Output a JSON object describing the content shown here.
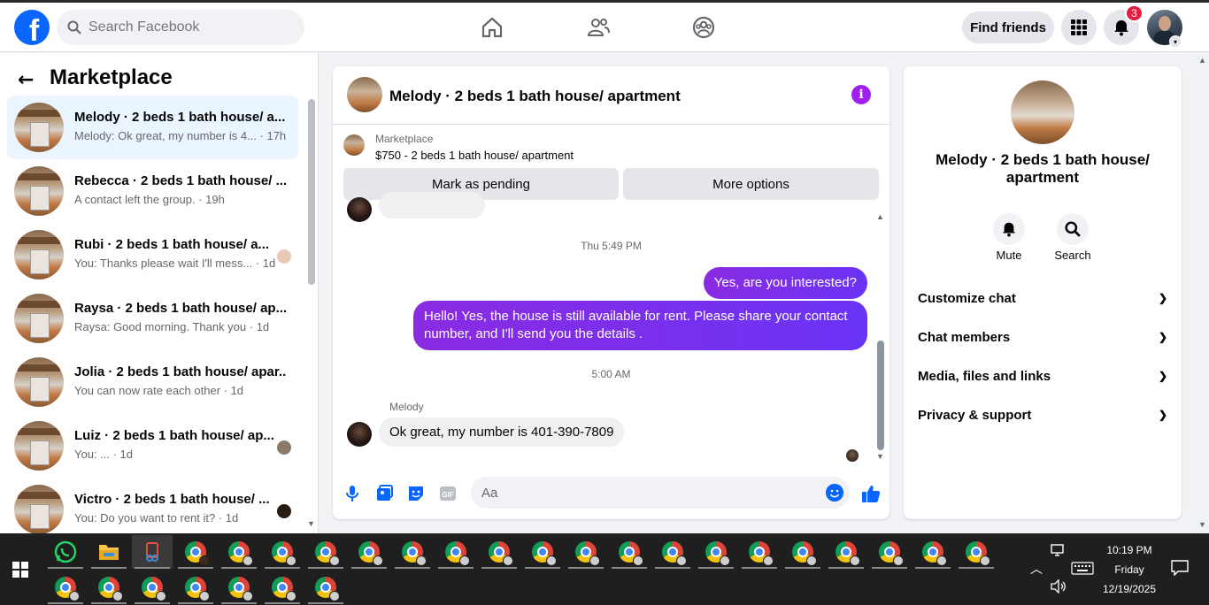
{
  "header": {
    "search_placeholder": "Search Facebook",
    "find_friends": "Find friends",
    "notification_count": "3",
    "logo_letter": "f"
  },
  "sidebar": {
    "title": "Marketplace",
    "conversations": [
      {
        "name": "Melody · 2 beds 1 bath house/ a...",
        "preview": "Melody: Ok great, my number is 4... · 17h",
        "active": true
      },
      {
        "name": "Rebecca · 2 beds 1 bath house/ ...",
        "preview": "A contact left the group. · 19h"
      },
      {
        "name": "Rubi · 2 beds 1 bath house/ a...",
        "preview": "You: Thanks please wait I'll mess... · 1d"
      },
      {
        "name": "Raysa · 2 beds 1 bath house/ ap...",
        "preview": "Raysa: Good morning. Thank you · 1d"
      },
      {
        "name": "Jolia · 2 beds 1 bath house/ apar...",
        "preview": "You can now rate each other · 1d"
      },
      {
        "name": "Luiz · 2 beds 1 bath house/ ap...",
        "preview": "You: ... · 1d"
      },
      {
        "name": "Victro · 2 beds 1 bath house/ ...",
        "preview": "You: Do you want to rent it? · 1d"
      }
    ]
  },
  "chat": {
    "title": "Melody · 2 beds 1 bath house/ apartment",
    "marketplace_label": "Marketplace",
    "listing": "$750 - 2 beds 1 bath house/ apartment",
    "mark_pending": "Mark as pending",
    "more_options": "More options",
    "timestamp_1": "Thu 5:49 PM",
    "out_msg_1": "Yes, are you interested?",
    "out_msg_2": "Hello! Yes, the house is still available for rent. Please share your contact number, and I'll send you the details .",
    "timestamp_2": "5:00 AM",
    "sender": "Melody",
    "in_msg": "Ok great, my number is 401-390-7809",
    "composer_placeholder": "Aa"
  },
  "details": {
    "name": "Melody · 2 beds 1 bath house/ apartment",
    "mute": "Mute",
    "search": "Search",
    "sections": [
      "Customize chat",
      "Chat members",
      "Media, files and links",
      "Privacy & support"
    ]
  },
  "taskbar": {
    "time": "10:19 PM",
    "day": "Friday",
    "date": "12/19/2025"
  },
  "colors": {
    "brand": "#0866ff",
    "bubble_out": "#7b2ff7",
    "active_conv": "#ebf5ff"
  }
}
